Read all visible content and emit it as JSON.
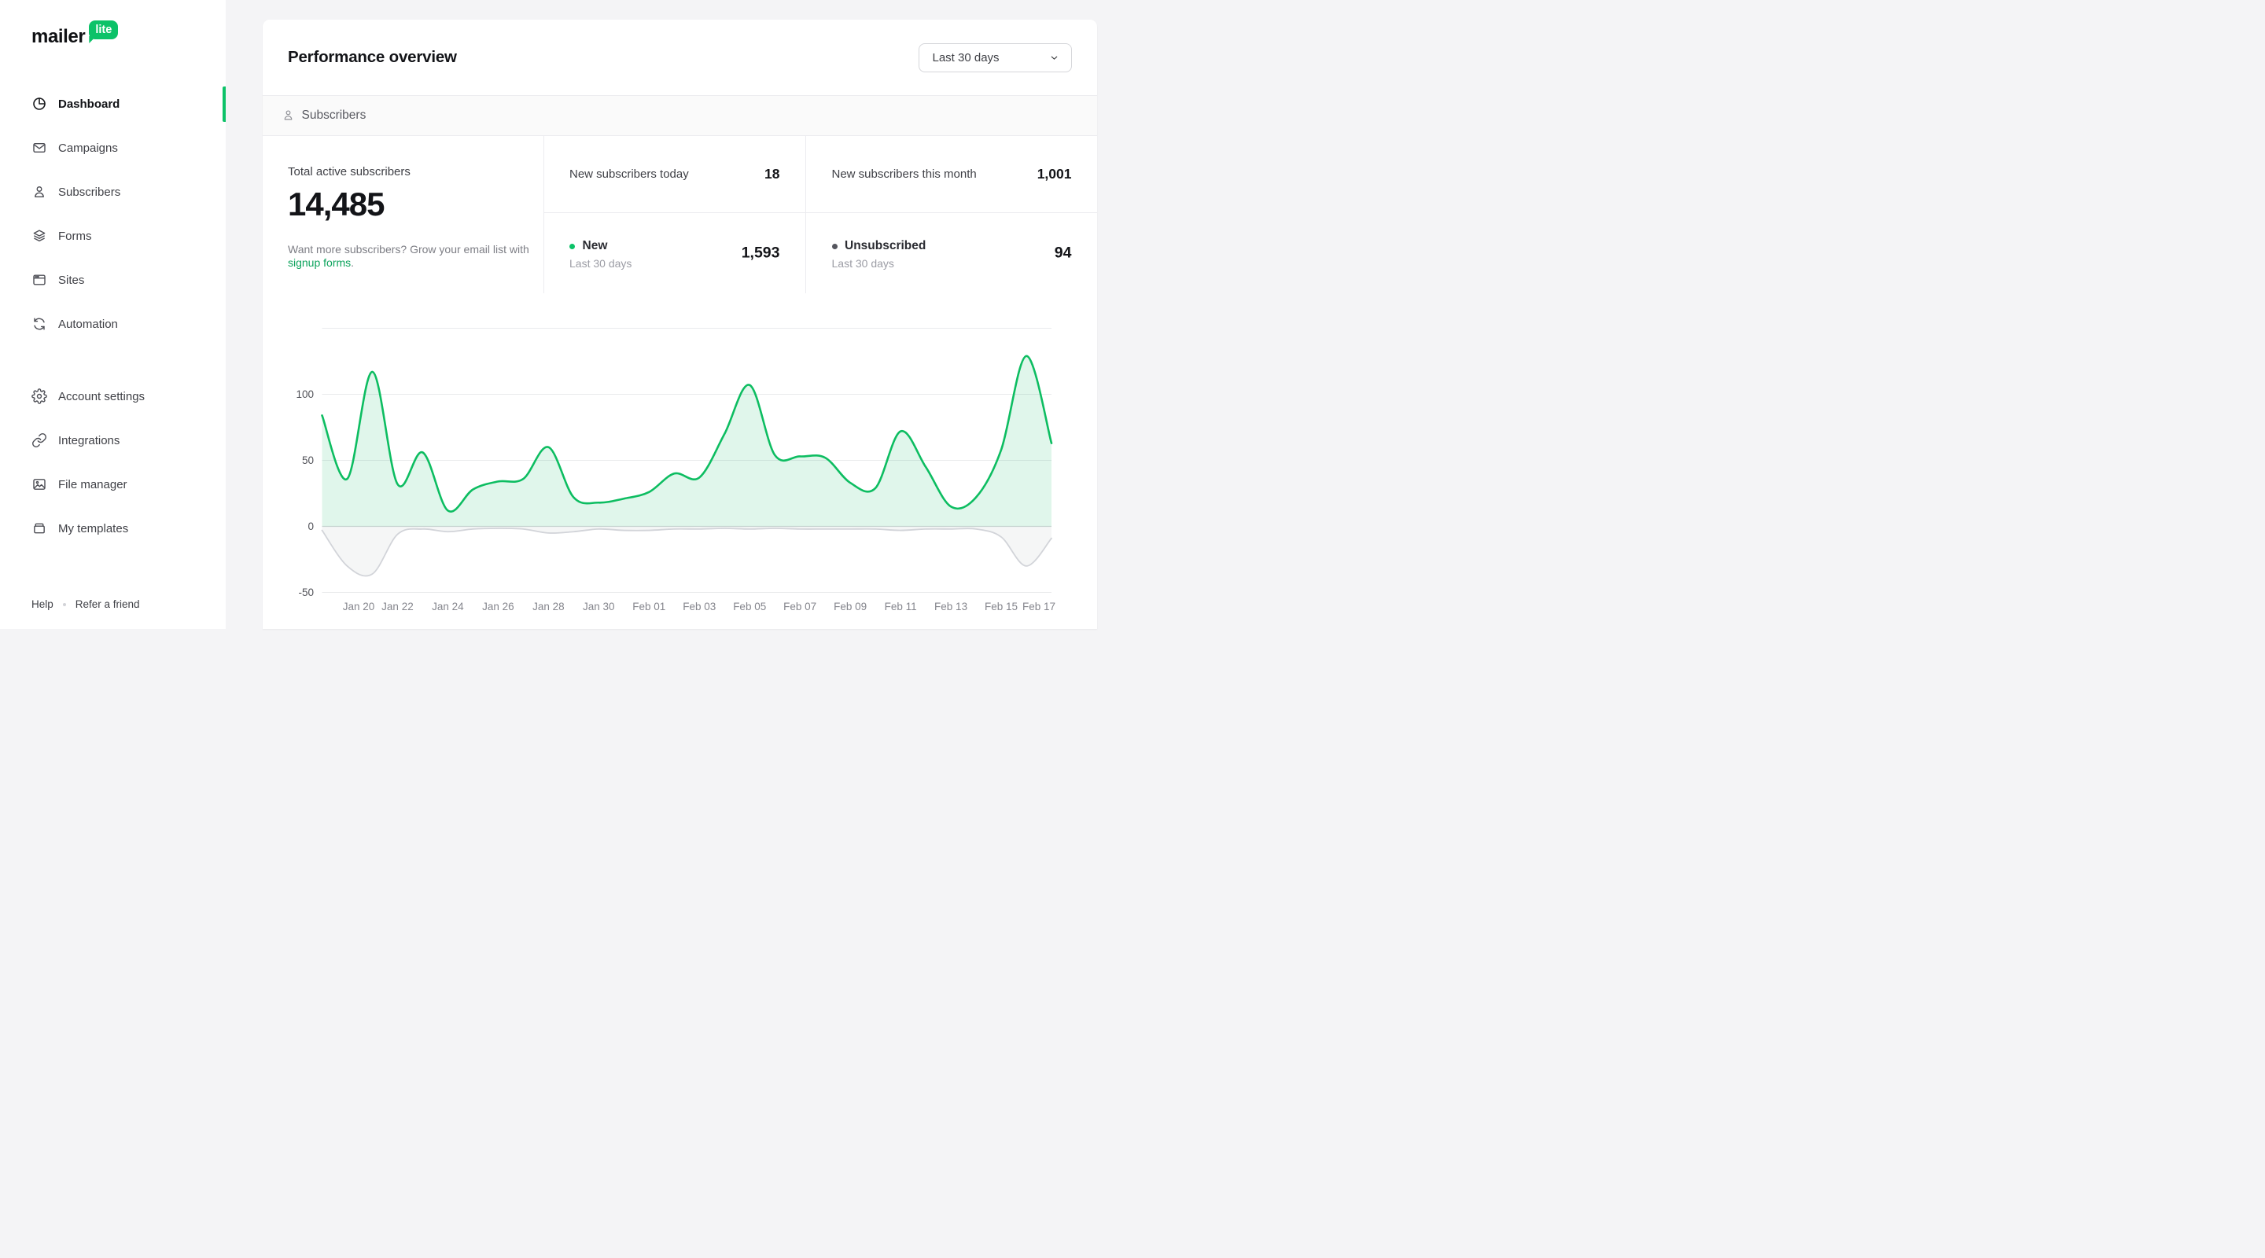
{
  "brand": {
    "name": "mailer",
    "badge": "lite",
    "accent_color": "#0cc268"
  },
  "sidebar": {
    "primary": [
      {
        "label": "Dashboard",
        "icon": "dashboard-icon",
        "active": true
      },
      {
        "label": "Campaigns",
        "icon": "campaigns-icon",
        "active": false
      },
      {
        "label": "Subscribers",
        "icon": "subscribers-icon",
        "active": false
      },
      {
        "label": "Forms",
        "icon": "forms-icon",
        "active": false
      },
      {
        "label": "Sites",
        "icon": "sites-icon",
        "active": false
      },
      {
        "label": "Automation",
        "icon": "automation-icon",
        "active": false
      }
    ],
    "secondary": [
      {
        "label": "Account settings",
        "icon": "settings-icon",
        "active": false
      },
      {
        "label": "Integrations",
        "icon": "integrations-icon",
        "active": false
      },
      {
        "label": "File manager",
        "icon": "file-manager-icon",
        "active": false
      },
      {
        "label": "My templates",
        "icon": "templates-icon",
        "active": false
      }
    ],
    "footer": {
      "help": "Help",
      "refer": "Refer a friend"
    }
  },
  "header": {
    "title": "Performance overview",
    "range": "Last 30 days"
  },
  "section": {
    "title": "Subscribers"
  },
  "stats": {
    "total": {
      "label": "Total active subscribers",
      "value": "14,485",
      "desc": "Want more subscribers? Grow your email list with",
      "link": "signup forms",
      "desc_end": "."
    },
    "today": {
      "label": "New subscribers today",
      "value": "18"
    },
    "month": {
      "label": "New subscribers this month",
      "value": "1,001"
    },
    "new30": {
      "label": "New",
      "sublabel": "Last 30 days",
      "value": "1,593",
      "dot_color": "#0cc268"
    },
    "unsub30": {
      "label": "Unsubscribed",
      "sublabel": "Last 30 days",
      "value": "94",
      "dot_color": "#55565e"
    }
  },
  "chart_data": {
    "type": "area",
    "title": "",
    "xlabel": "",
    "ylabel": "",
    "x": [
      "Jan 19",
      "Jan 20",
      "Jan 21",
      "Jan 22",
      "Jan 23",
      "Jan 24",
      "Jan 25",
      "Jan 26",
      "Jan 27",
      "Jan 28",
      "Jan 29",
      "Jan 30",
      "Jan 31",
      "Feb 01",
      "Feb 02",
      "Feb 03",
      "Feb 04",
      "Feb 05",
      "Feb 06",
      "Feb 07",
      "Feb 08",
      "Feb 09",
      "Feb 10",
      "Feb 11",
      "Feb 12",
      "Feb 13",
      "Feb 14",
      "Feb 15",
      "Feb 16",
      "Feb 17"
    ],
    "x_tick_labels": [
      "Jan 20",
      "Jan 22",
      "Jan 24",
      "Jan 26",
      "Jan 28",
      "Jan 30",
      "Feb 01",
      "Feb 03",
      "Feb 05",
      "Feb 07",
      "Feb 09",
      "Feb 11",
      "Feb 13",
      "Feb 15",
      "Feb 17"
    ],
    "y_ticks": [
      100,
      50,
      0,
      -50
    ],
    "y_gridlines": [
      150,
      100,
      50,
      0,
      -50
    ],
    "ylim": [
      -50,
      150
    ],
    "grid": true,
    "legend": "none",
    "series": [
      {
        "name": "New",
        "color": "#0dbd61",
        "fill": "rgba(13,189,97,0.13)",
        "values": [
          84,
          36,
          117,
          32,
          56,
          12,
          28,
          34,
          36,
          60,
          22,
          18,
          21,
          26,
          40,
          37,
          70,
          107,
          54,
          53,
          52,
          33,
          29,
          72,
          45,
          15,
          22,
          58,
          129,
          63
        ]
      },
      {
        "name": "Unsubscribed",
        "color": "#d2d4d9",
        "fill": "rgba(161,163,170,0.10)",
        "values": [
          -3,
          -30,
          -36,
          -6,
          -2,
          -4,
          -2,
          -1.5,
          -2,
          -5,
          -4,
          -2,
          -3,
          -3,
          -2,
          -2,
          -1.5,
          -2,
          -1.5,
          -2,
          -2,
          -2,
          -2,
          -3,
          -2,
          -2,
          -2,
          -8,
          -30,
          -9
        ]
      }
    ]
  }
}
